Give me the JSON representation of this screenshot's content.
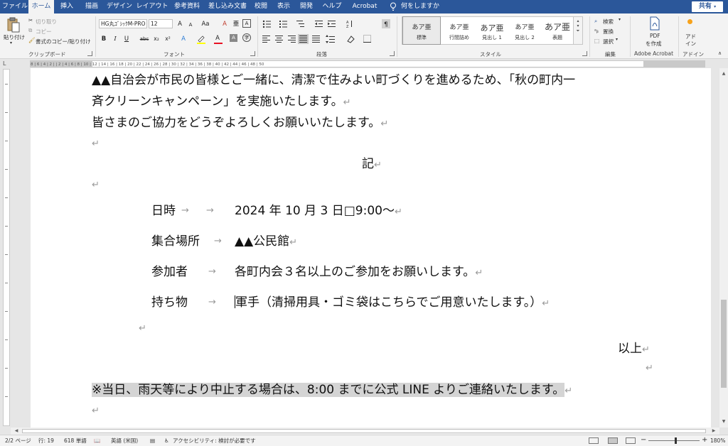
{
  "tabs": [
    {
      "label": "ファイル",
      "active": false
    },
    {
      "label": "ホーム",
      "active": true
    },
    {
      "label": "挿入",
      "active": false
    },
    {
      "label": "描画",
      "active": false
    },
    {
      "label": "デザイン",
      "active": false
    },
    {
      "label": "レイアウト",
      "active": false
    },
    {
      "label": "参考資料",
      "active": false
    },
    {
      "label": "差し込み文書",
      "active": false
    },
    {
      "label": "校閲",
      "active": false
    },
    {
      "label": "表示",
      "active": false
    },
    {
      "label": "開発",
      "active": false
    },
    {
      "label": "ヘルプ",
      "active": false
    },
    {
      "label": "Acrobat",
      "active": false
    }
  ],
  "tell_me": "何をしますか",
  "share_label": "共有",
  "clipboard": {
    "paste": "貼り付け",
    "cut": "切り取り",
    "copy": "コピー",
    "format_painter": "書式のコピー/貼り付け",
    "group_label": "クリップボード"
  },
  "font": {
    "font_name": "HG丸ｺﾞｼｯｸM-PRO",
    "font_size": "12",
    "group_label": "フォント",
    "grow": "A",
    "shrink": "A",
    "case": "Aa",
    "bold": "B",
    "italic": "I",
    "underline": "U",
    "strike": "abc",
    "subscript": "x₂",
    "superscript": "x²",
    "clear": "A",
    "color_a": "A",
    "char_border": "A",
    "phonetic": "亜",
    "enclose": "字",
    "char_shade": "A",
    "highlight_color": "#ffff00",
    "font_color": "#e81123"
  },
  "paragraph": {
    "group_label": "段落"
  },
  "styles": {
    "group_label": "スタイル",
    "items": [
      {
        "sample": "あア亜",
        "name": "標準",
        "active": true
      },
      {
        "sample": "あア亜",
        "name": "行間詰め",
        "active": false
      },
      {
        "sample": "あア亜",
        "name": "見出し 1",
        "active": false
      },
      {
        "sample": "あア亜",
        "name": "見出し 2",
        "active": false
      },
      {
        "sample": "あア亜",
        "name": "表題",
        "active": false
      }
    ]
  },
  "editing": {
    "group_label": "編集",
    "find": "検索",
    "replace": "置換",
    "select": "選択"
  },
  "acrobat": {
    "pdf_line1": "PDF",
    "pdf_line2": "を作成",
    "group_label": "Adobe Acrobat"
  },
  "addins": {
    "line1": "アド",
    "line2": "イン",
    "group_label": "アドイン"
  },
  "ruler_labels": "8  |  6  |  4  |  2  |     |  2  |  4  |  6  |  8  |  10  |  12  |  14  |  16  |  18  |  20  |  22  |  24  |  26  |  28  |  30  |  32  |  34  |  36  |  38  |  40  |  42  |  44  |  46  |  48  |  50",
  "document": {
    "line1": "▲▲自治会が市民の皆様とご一緒に、清潔で住みよい町づくりを進めるため、「秋の町内一",
    "line2": "斉クリーンキャンペーン」を実施いたします。",
    "line3": "皆さまのご協力をどうぞよろしくお願いいたします。",
    "ki": "記",
    "items": [
      {
        "label": "日時",
        "arrow1": "→",
        "arrow2": "→",
        "value": "2024 年 10 月 3 日□9:00～"
      },
      {
        "label": "集合場所",
        "arrow1": "",
        "arrow2": "→",
        "value": "▲▲公民館"
      },
      {
        "label": "参加者",
        "arrow1": "",
        "arrow2": "→",
        "value": "各町内会３名以上のご参加をお願いします。"
      },
      {
        "label": "持ち物",
        "arrow1": "",
        "arrow2": "→",
        "value": "軍手（清掃用具・ゴミ袋はこちらでご用意いたします。）"
      }
    ],
    "ijou": "以上",
    "note": "※当日、雨天等により中止する場合は、8:00 までに公式 LINE よりご連絡いたします。",
    "para_mark": "↵"
  },
  "status": {
    "page": "2/2 ページ",
    "line": "行: 19",
    "words": "618 単語",
    "language": "英語 (米国)",
    "accessibility": "アクセシビリティ: 検討が必要です",
    "zoom": "180%",
    "zoom_minus": "−",
    "zoom_plus": "+"
  }
}
